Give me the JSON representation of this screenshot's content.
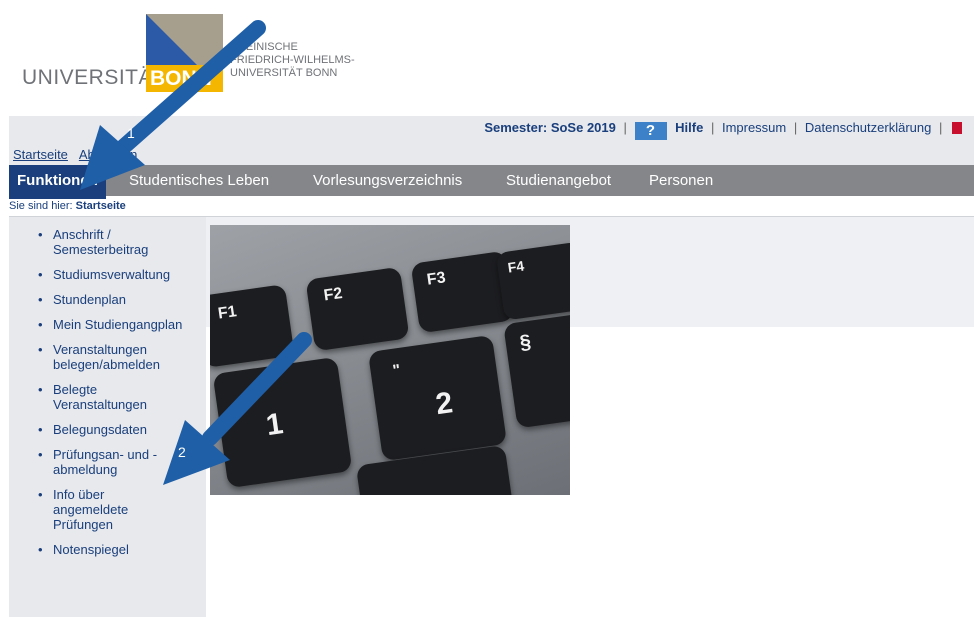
{
  "logo": {
    "university": "UNIVERSITÄT",
    "bonn": "BONN",
    "line1": "RHEINISCHE",
    "line2": "FRIEDRICH-WILHELMS-",
    "line3": "UNIVERSITÄT BONN"
  },
  "meta": {
    "semester": "Semester: SoSe 2019",
    "help_icon": "?",
    "help": "Hilfe",
    "impressum": "Impressum",
    "privacy": "Datenschutzerklärung"
  },
  "top_links": {
    "home": "Startseite",
    "logout": "Abmelden"
  },
  "nav": {
    "items": [
      "Funktionen",
      "Studentisches Leben",
      "Vorlesungsverzeichnis",
      "Studienangebot",
      "Personen"
    ]
  },
  "breadcrumb": {
    "prefix": "Sie sind hier:",
    "current": "Startseite"
  },
  "sidebar": {
    "items": [
      "Anschrift / Semesterbeitrag",
      "Studiumsverwaltung",
      "Stundenplan",
      "Mein Studiengangplan",
      "Veranstaltungen belegen/abmelden",
      "Belegte Veranstaltungen",
      "Belegungsdaten",
      "Prüfungsan- und -abmeldung",
      "Info über angemeldete Prüfungen",
      "Notenspiegel"
    ]
  },
  "annotations": {
    "arrow1": "1",
    "arrow2": "2",
    "arrow_color": "#1f5fa8"
  },
  "photo": {
    "keys": [
      "F1",
      "F2",
      "F3",
      "F4",
      "1",
      "2",
      "§",
      "\""
    ]
  }
}
